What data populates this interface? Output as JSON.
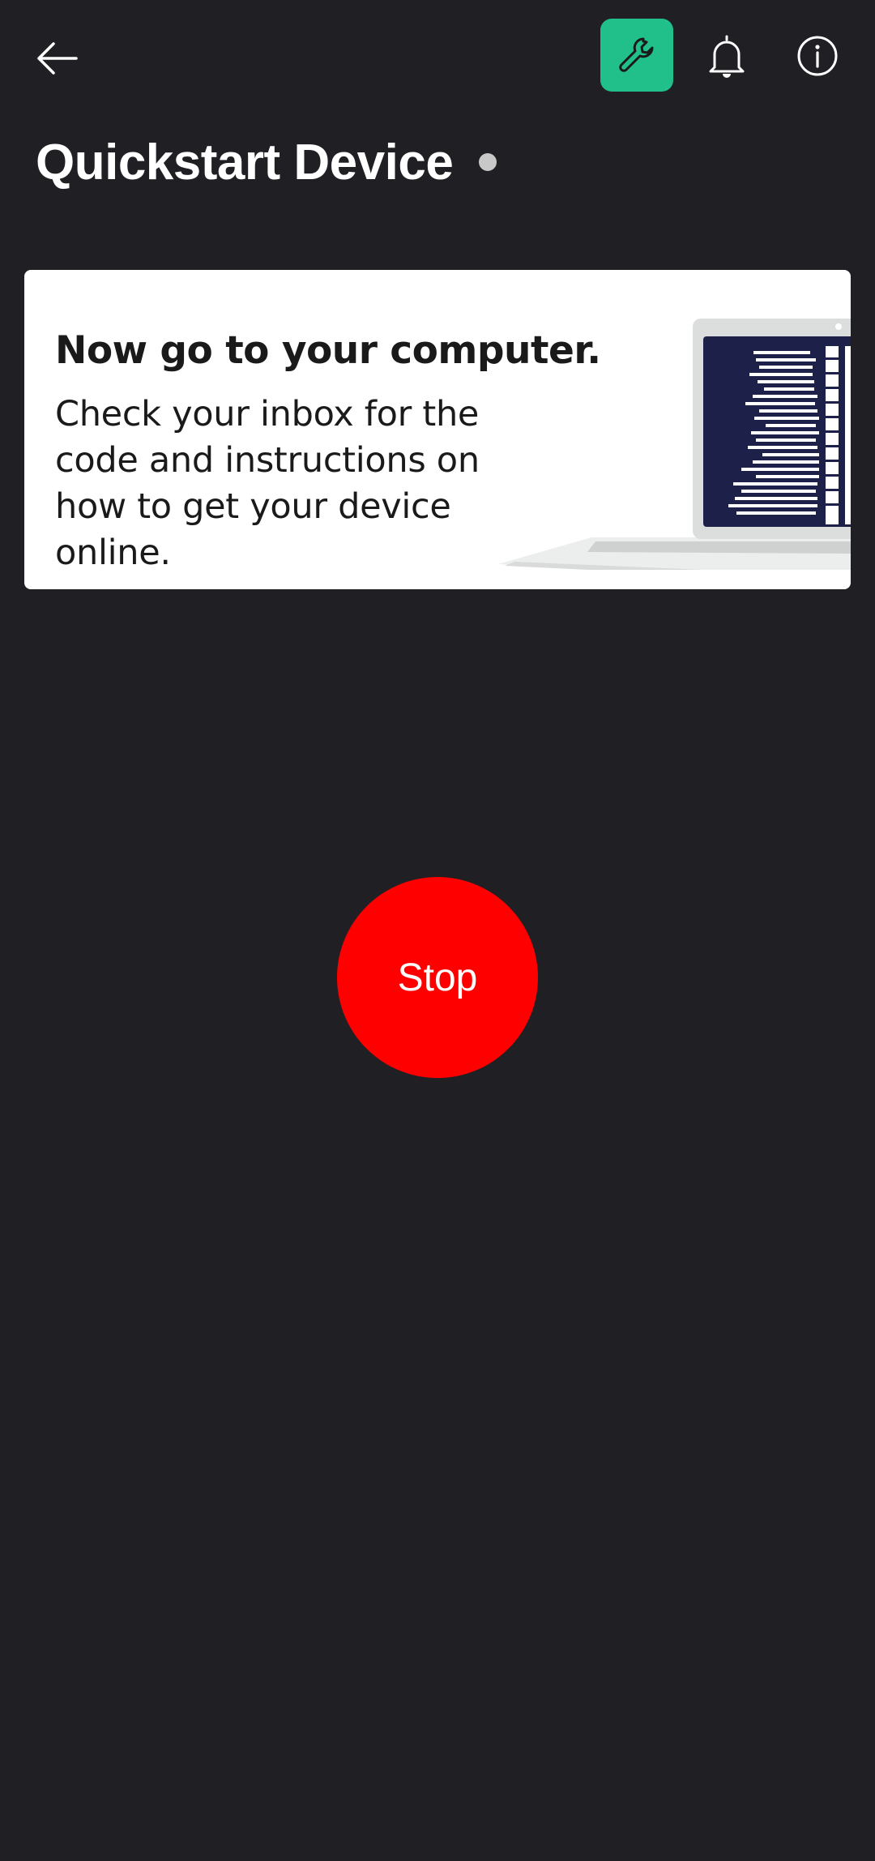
{
  "header": {
    "back_icon": "arrow-left-icon",
    "tools_icon": "wrench-icon",
    "tools_color": "#21c08b",
    "notifications_icon": "bell-icon",
    "info_icon": "info-icon"
  },
  "device": {
    "title": "Quickstart Device",
    "status_dot_color": "#c8c8c8"
  },
  "card": {
    "heading": "Now go to your computer.",
    "body": "Check your inbox for the code and instructions on how to get your device online.",
    "illustration_icon": "laptop-icon"
  },
  "action": {
    "stop_label": "Stop",
    "stop_color": "#ff0000"
  }
}
